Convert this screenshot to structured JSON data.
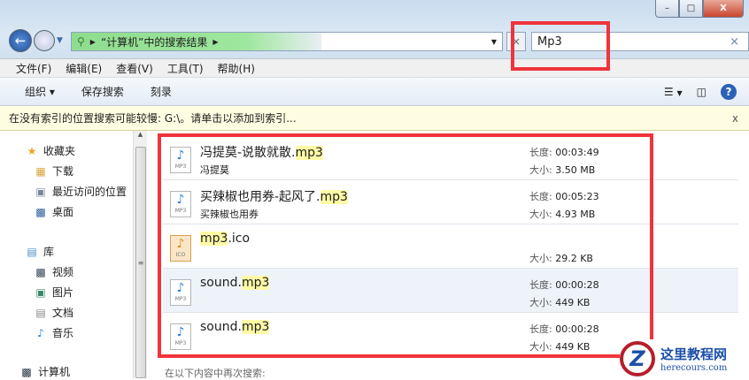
{
  "window": {
    "minimize": "–",
    "maximize": "□",
    "close": "X"
  },
  "address": {
    "path": "“计算机”中的搜索结果",
    "search_value": "Mp3",
    "clear": "×"
  },
  "menu": [
    "文件(F)",
    "编辑(E)",
    "查看(V)",
    "工具(T)",
    "帮助(H)"
  ],
  "toolbar": {
    "organize": "组织 ▾",
    "save_search": "保存搜索",
    "burn": "刻录",
    "help": "?"
  },
  "infobar": {
    "text": "在没有索引的位置搜索可能较慢: G:\\。请单击以添加到索引...",
    "close": "x"
  },
  "sidebar": {
    "favorites": "收藏夹",
    "downloads": "下载",
    "recent": "最近访问的位置",
    "desktop": "桌面",
    "libraries": "库",
    "videos": "视频",
    "pictures": "图片",
    "documents": "文档",
    "music": "音乐",
    "computer": "计算机"
  },
  "labels": {
    "length": "长度:",
    "size": "大小:"
  },
  "files": [
    {
      "base": "冯提莫-说散就散.",
      "match": "mp3",
      "rest": "",
      "artist": "冯提莫",
      "length": "00:03:49",
      "size": "3.50 MB"
    },
    {
      "base": "买辣椒也用券-起风了.",
      "match": "mp3",
      "rest": "",
      "artist": "买辣椒也用券",
      "length": "00:05:23",
      "size": "4.93 MB"
    },
    {
      "base": "",
      "match": "mp3",
      "rest": ".ico",
      "artist": "",
      "size": "29.2 KB"
    },
    {
      "base": "sound.",
      "match": "mp3",
      "rest": "",
      "artist": "",
      "length": "00:00:28",
      "size": "449 KB"
    },
    {
      "base": "sound.",
      "match": "mp3",
      "rest": "",
      "artist": "",
      "length": "00:00:28",
      "size": "449 KB"
    }
  ],
  "bottom": "在以下内容中再次搜索:",
  "watermark": {
    "name": "这里教程网",
    "url": "herecours.com",
    "logo": "Z"
  }
}
